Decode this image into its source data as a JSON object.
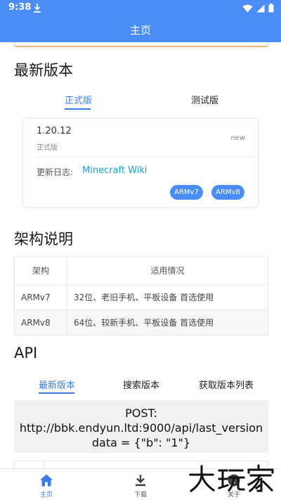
{
  "status_bar": {
    "time": "9:38"
  },
  "app_bar": {
    "title": "主页"
  },
  "latest_section": {
    "title": "最新版本",
    "tabs": [
      {
        "label": "正式版",
        "active": true
      },
      {
        "label": "测试版",
        "active": false
      }
    ],
    "card": {
      "version": "1.20.12",
      "channel": "正式版",
      "badge": "new",
      "changelog_label": "更新日志:",
      "changelog_link": "Minecraft Wiki",
      "archs": [
        "ARMv7",
        "ARMv8"
      ]
    }
  },
  "arch_section": {
    "title": "架构说明",
    "headers": [
      "架构",
      "适用情况"
    ],
    "rows": [
      {
        "arch": "ARMv7",
        "usage": "32位、老旧手机、平板设备 首选使用"
      },
      {
        "arch": "ARMv8",
        "usage": "64位、较新手机、平板设备 首选使用"
      }
    ]
  },
  "api_section": {
    "title": "API",
    "tabs": [
      {
        "label": "最新版本",
        "active": true
      },
      {
        "label": "搜索版本",
        "active": false
      },
      {
        "label": "获取版本列表",
        "active": false
      }
    ],
    "request": {
      "method": "POST:",
      "url": "http://bbk.endyun.ltd:9000/api/last_version",
      "body": "data = {\"b\": \"1\"}"
    }
  },
  "bottom_nav": {
    "items": [
      {
        "label": "主页",
        "icon": "home-icon",
        "active": true
      },
      {
        "label": "下载",
        "icon": "download-icon",
        "active": false
      },
      {
        "label": "关于",
        "icon": "info-icon",
        "active": false
      }
    ]
  },
  "watermark": {
    "text": "大玩家"
  },
  "colors": {
    "primary": "#4a8ef5",
    "accent": "#3a7be8",
    "link": "#1aa0d8"
  }
}
